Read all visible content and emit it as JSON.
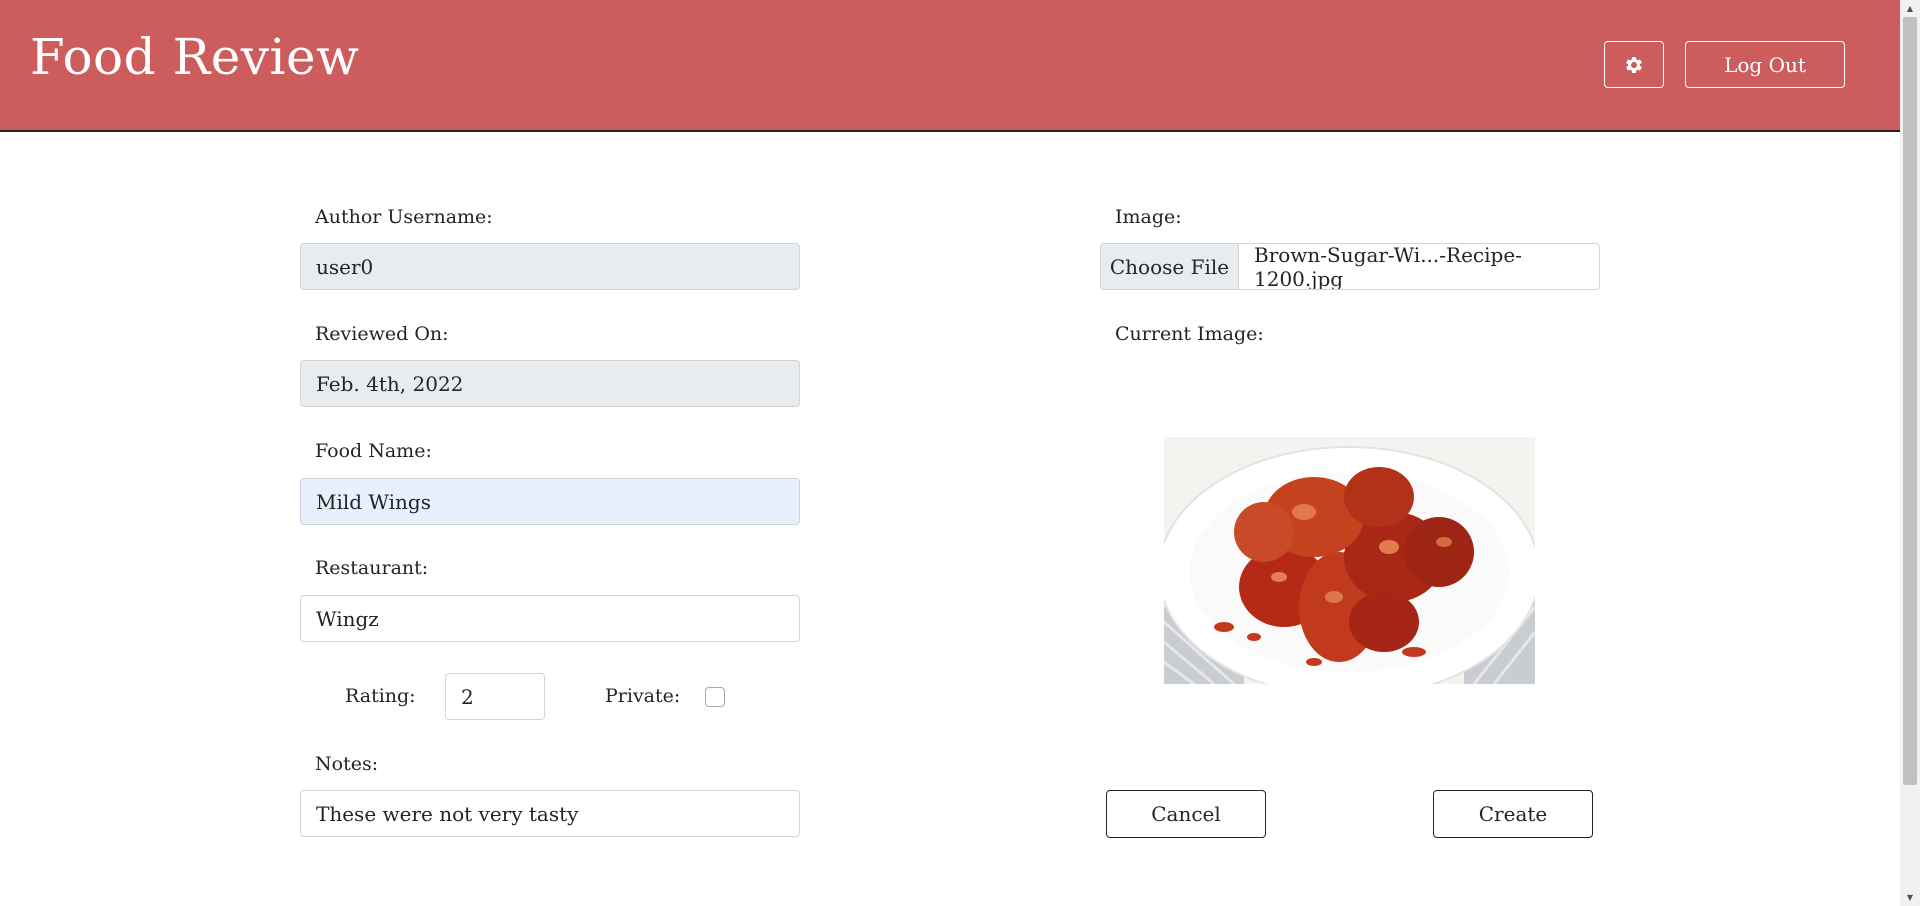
{
  "header": {
    "title": "Food Review",
    "settings_icon": "gear-icon",
    "logout_label": "Log Out"
  },
  "form": {
    "author_label": "Author Username:",
    "author_value": "user0",
    "reviewed_label": "Reviewed On:",
    "reviewed_value": "Feb. 4th, 2022",
    "food_label": "Food Name:",
    "food_value": "Mild Wings",
    "restaurant_label": "Restaurant:",
    "restaurant_value": "Wingz",
    "rating_label": "Rating:",
    "rating_value": "2",
    "private_label": "Private:",
    "private_checked": false,
    "notes_label": "Notes:",
    "notes_value": "These were not very tasty",
    "image_label": "Image:",
    "choose_file_label": "Choose File",
    "file_name": "Brown-Sugar-Wi...-Recipe-1200.jpg",
    "current_image_label": "Current Image:"
  },
  "actions": {
    "cancel_label": "Cancel",
    "create_label": "Create"
  },
  "colors": {
    "header_bg": "#cd5c5c",
    "readonly_bg": "#e9ecef",
    "autofill_bg": "#e8f0fe"
  }
}
